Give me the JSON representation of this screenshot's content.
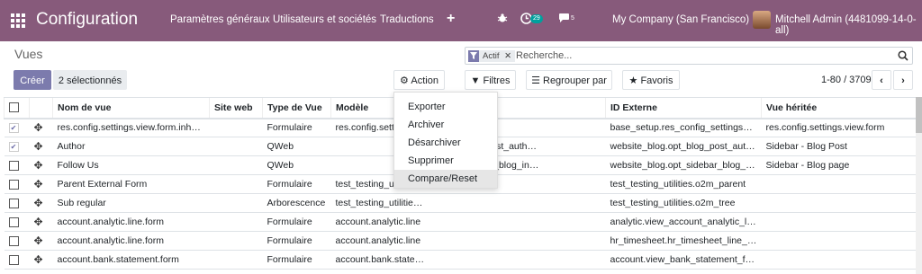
{
  "app": {
    "title": "Configuration",
    "menu": [
      "Paramètres généraux",
      "Utilisateurs et sociétés",
      "Traductions"
    ],
    "plus": "+",
    "activity_count": "29",
    "message_count": "5",
    "company": "My Company (San Francisco)",
    "user": "Mitchell Admin (4481099-14-0-all)"
  },
  "control": {
    "breadcrumb": "Vues",
    "create": "Créer",
    "selected": "2 sélectionnés",
    "action": "Action",
    "filters": "Filtres",
    "group_by": "Regrouper par",
    "favorites": "Favoris",
    "facet": "Actif",
    "search_placeholder": "Recherche...",
    "pager": "1-80 / 3709"
  },
  "action_menu": [
    "Exporter",
    "Archiver",
    "Désarchiver",
    "Supprimer",
    "Compare/Reset"
  ],
  "table": {
    "headers": [
      "Nom de vue",
      "Site web",
      "Type de Vue",
      "Modèle",
      "",
      "ID Externe",
      "Vue héritée"
    ],
    "rows": [
      {
        "checked": true,
        "name": "res.config.settings.view.form.inher…",
        "site": "",
        "type": "Formulaire",
        "model": "res.config.setti",
        "model2": "",
        "xid": "base_setup.res_config_settings_v…",
        "inherit": "res.config.settings.view.form"
      },
      {
        "checked": true,
        "name": "Author",
        "site": "",
        "type": "QWeb",
        "model": "",
        "model2": "g.opt_blog_post_auth…",
        "xid": "website_blog.opt_blog_post_auth…",
        "inherit": "Sidebar - Blog Post"
      },
      {
        "checked": false,
        "name": "Follow Us",
        "site": "",
        "type": "QWeb",
        "model": "",
        "model2": "g.opt_sidebar_blog_in…",
        "xid": "website_blog.opt_sidebar_blog_in…",
        "inherit": "Sidebar - Blog page"
      },
      {
        "checked": false,
        "name": "Parent External Form",
        "site": "",
        "type": "Formulaire",
        "model": "test_testing_uti",
        "model2": "",
        "xid": "test_testing_utilities.o2m_parent",
        "inherit": ""
      },
      {
        "checked": false,
        "name": "Sub regular",
        "site": "",
        "type": "Arborescence",
        "model": "test_testing_utilities.sub",
        "model2": "",
        "xid": "test_testing_utilities.o2m_tree",
        "inherit": ""
      },
      {
        "checked": false,
        "name": "account.analytic.line.form",
        "site": "",
        "type": "Formulaire",
        "model": "account.analytic.line",
        "model2": "",
        "xid": "analytic.view_account_analytic_li…",
        "inherit": ""
      },
      {
        "checked": false,
        "name": "account.analytic.line.form",
        "site": "",
        "type": "Formulaire",
        "model": "account.analytic.line",
        "model2": "",
        "xid": "hr_timesheet.hr_timesheet_line_f…",
        "inherit": ""
      },
      {
        "checked": false,
        "name": "account.bank.statement.form",
        "site": "",
        "type": "Formulaire",
        "model": "account.bank.statement",
        "model2": "",
        "xid": "account.view_bank_statement_form",
        "inherit": ""
      }
    ]
  }
}
